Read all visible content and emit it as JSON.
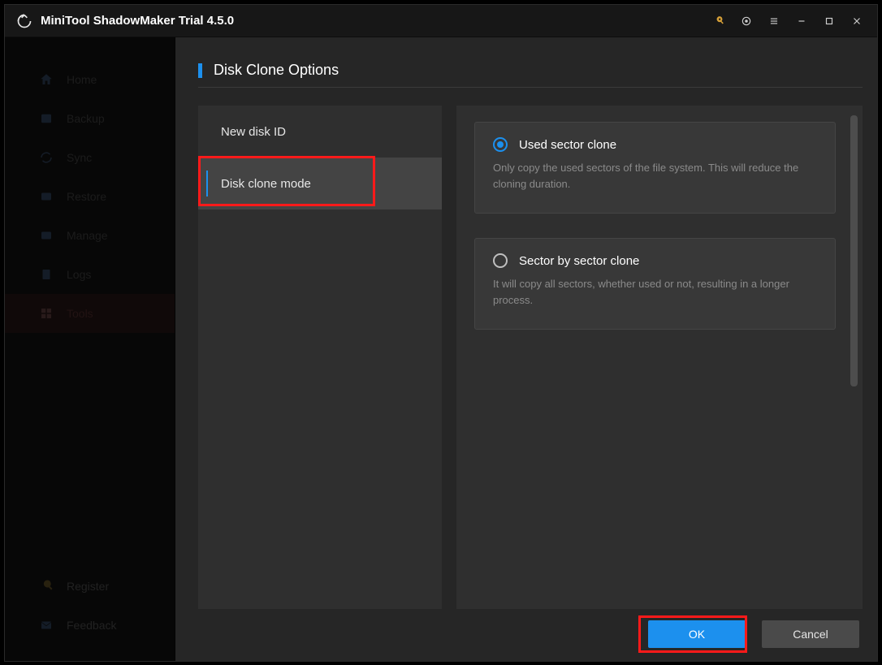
{
  "app": {
    "title": "MiniTool ShadowMaker Trial 4.5.0"
  },
  "titlebar_icons": [
    "key",
    "disk",
    "menu",
    "minimize",
    "maximize",
    "close"
  ],
  "sidebar": {
    "items": [
      {
        "id": "home",
        "label": "Home",
        "icon": "home"
      },
      {
        "id": "backup",
        "label": "Backup",
        "icon": "backup"
      },
      {
        "id": "sync",
        "label": "Sync",
        "icon": "sync"
      },
      {
        "id": "restore",
        "label": "Restore",
        "icon": "restore"
      },
      {
        "id": "manage",
        "label": "Manage",
        "icon": "manage"
      },
      {
        "id": "logs",
        "label": "Logs",
        "icon": "logs"
      },
      {
        "id": "tools",
        "label": "Tools",
        "icon": "tools",
        "active": true
      }
    ],
    "footer": [
      {
        "id": "register",
        "label": "Register",
        "icon": "key"
      },
      {
        "id": "feedback",
        "label": "Feedback",
        "icon": "mail"
      }
    ]
  },
  "page": {
    "title": "Disk Clone Options",
    "left_items": [
      {
        "id": "new_disk_id",
        "label": "New disk ID",
        "selected": false
      },
      {
        "id": "disk_clone_mode",
        "label": "Disk clone mode",
        "selected": true
      }
    ],
    "options": [
      {
        "id": "used_sector",
        "title": "Used sector clone",
        "desc": "Only copy the used sectors of the file system. This will reduce the cloning duration.",
        "selected": true
      },
      {
        "id": "sector_by_sector",
        "title": "Sector by sector clone",
        "desc": "It will copy all sectors, whether used or not, resulting in a longer process.",
        "selected": false
      }
    ],
    "buttons": {
      "ok": "OK",
      "cancel": "Cancel"
    }
  }
}
